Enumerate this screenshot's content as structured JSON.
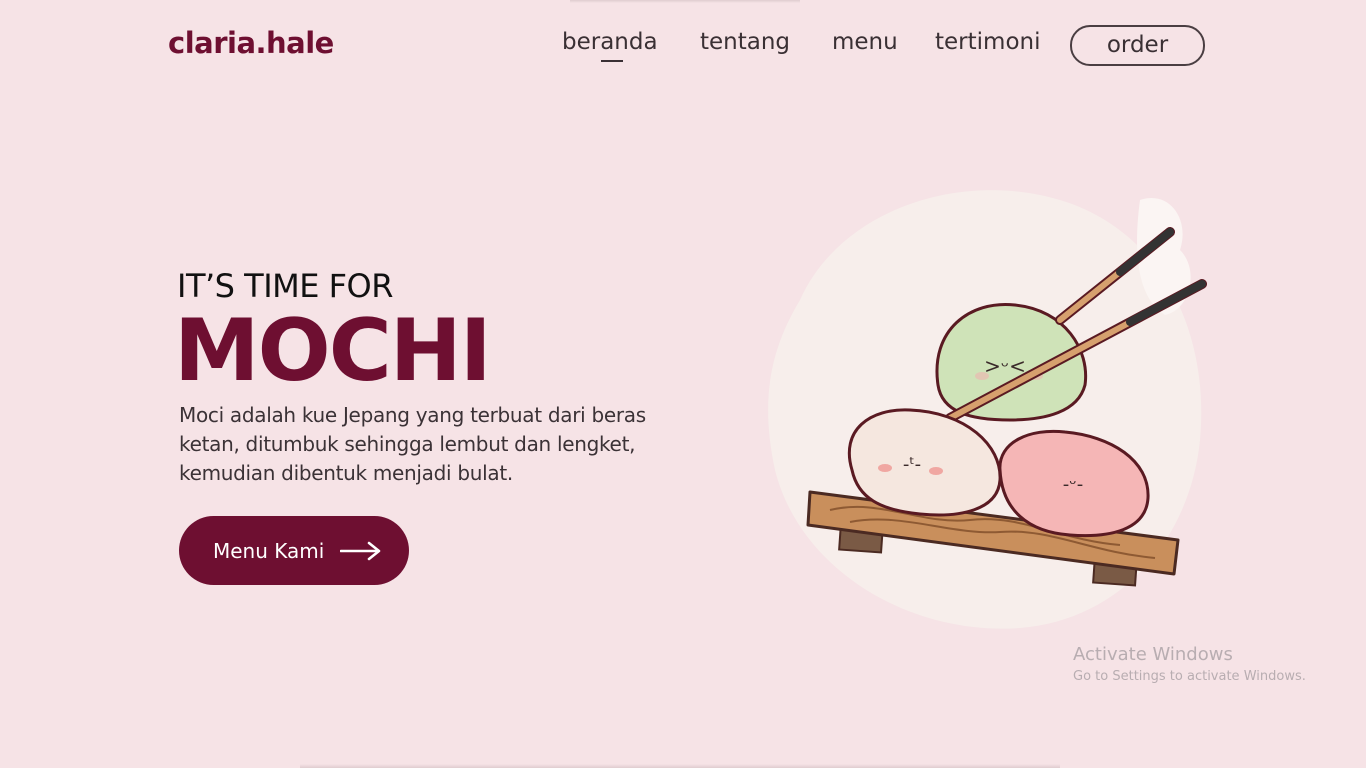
{
  "brand": {
    "logo": "claria.hale",
    "accent_color": "#6e0f31",
    "background_color": "#f6e3e6"
  },
  "nav": {
    "items": [
      {
        "label": "beranda",
        "active": true
      },
      {
        "label": "tentang",
        "active": false
      },
      {
        "label": "menu",
        "active": false
      },
      {
        "label": "tertimoni",
        "active": false
      }
    ],
    "order_label": "order"
  },
  "hero": {
    "kicker": "IT’S TIME FOR",
    "title": "MOCHI",
    "description": "Moci adalah kue Jepang yang terbuat dari beras ketan, ditumbuk sehingga lembut dan lengket, kemudian dibentuk menjadi bulat.",
    "cta_label": "Menu Kami",
    "cta_icon": "arrow-right-icon"
  },
  "illustration": {
    "subject": "mochi-illustration",
    "faces": [
      ">ᵕ<",
      "-ᵗ-",
      "-ᵕ-"
    ]
  },
  "watermark": {
    "title": "Activate Windows",
    "subtitle": "Go to Settings to activate Windows."
  }
}
